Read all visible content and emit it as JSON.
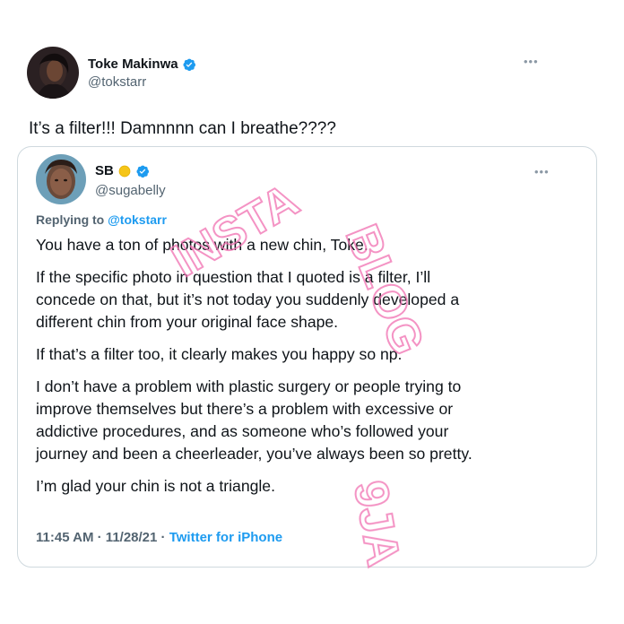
{
  "tweet": {
    "author": {
      "name": "Toke Makinwa",
      "handle": "@tokstarr",
      "verified": true,
      "avatar_icon": "profile-photo"
    },
    "text": "It’s a filter!!! Damnnnn can I breathe????",
    "more_icon": "more-horizontal-icon"
  },
  "quoted": {
    "author": {
      "name": "SB",
      "handle": "@sugabelly",
      "verified": true,
      "badge_emoji": "yellow-circle",
      "avatar_icon": "profile-photo"
    },
    "replying_to_label": "Replying to",
    "replying_to_handle": "@tokstarr",
    "paragraphs": [
      "You have a ton of photos with a new chin, Toke.",
      "If the specific photo in question that I quoted is a filter, I’ll",
      "concede on that, but it’s not today you suddenly developed a",
      "different chin from your original face shape.",
      "If that’s a filter too, it clearly makes you happy so np.",
      "I don’t have a problem with plastic surgery or people trying to",
      "improve themselves but there’s a problem with excessive or",
      "addictive procedures, and as someone who’s followed your",
      "journey and been a cheerleader, you’ve always been so pretty.",
      "I’m glad your chin is not a triangle."
    ],
    "time": "11:45 AM · 11/28/21 ·",
    "source": "Twitter for iPhone"
  },
  "watermark": {
    "text_top": "INSTA",
    "text_mid": "BLOG",
    "text_bot": "9JA",
    "color": "#f06fb0"
  },
  "colors": {
    "accent": "#1d9bf0",
    "secondary_text": "#536471",
    "border": "#cfd9de"
  }
}
